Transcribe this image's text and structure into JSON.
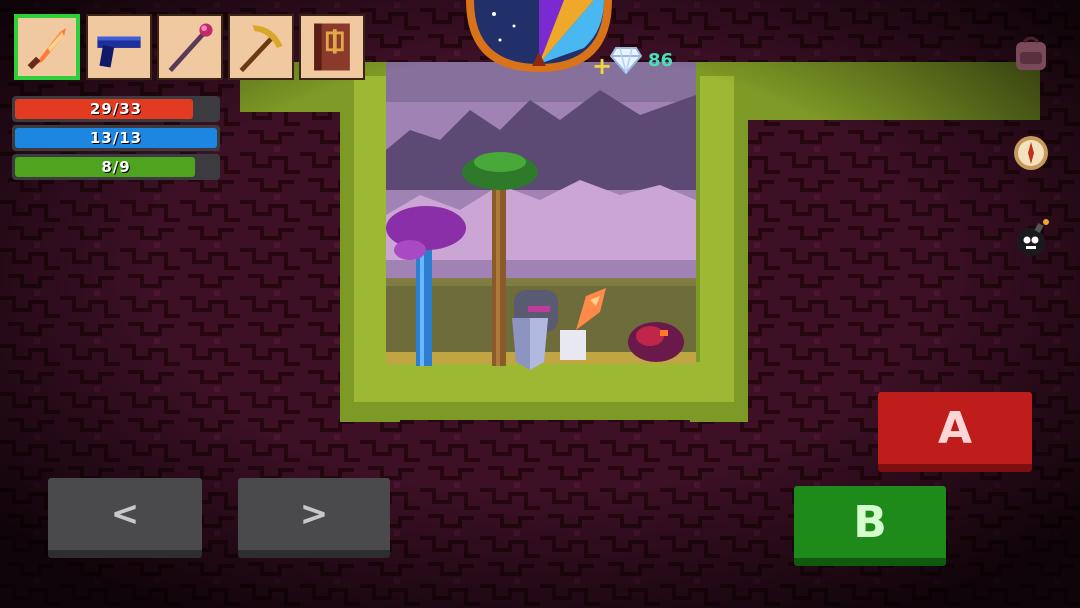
{
  "hotbar": {
    "selected_index": 0,
    "items": [
      {
        "name": "fire-sword",
        "icon": "flame-sword-icon"
      },
      {
        "name": "blue-pistol",
        "icon": "pistol-icon"
      },
      {
        "name": "magic-staff",
        "icon": "staff-icon"
      },
      {
        "name": "golden-pickaxe",
        "icon": "pickaxe-icon"
      },
      {
        "name": "spell-book",
        "icon": "book-icon"
      }
    ]
  },
  "stats": {
    "health": {
      "text": "29/33",
      "current": 29,
      "max": 33,
      "color": "#e23b22"
    },
    "mana": {
      "text": "13/13",
      "current": 13,
      "max": 13,
      "color": "#1d86e0"
    },
    "stamina": {
      "text": "8/9",
      "current": 8,
      "max": 9,
      "color": "#4ea41e"
    }
  },
  "currency": {
    "plus": "+",
    "gems": "86",
    "gem_icon": "diamond-icon"
  },
  "clock": {
    "icon": "day-night-clock-icon"
  },
  "side_buttons": [
    {
      "name": "backpack",
      "icon": "backpack-icon"
    },
    {
      "name": "compass",
      "icon": "compass-icon"
    },
    {
      "name": "bomb",
      "icon": "bomb-icon"
    }
  ],
  "controls": {
    "left": "<",
    "right": ">",
    "a": "A",
    "b": "B"
  },
  "colors": {
    "cave": "#3a1024",
    "moss": "#8aa32a",
    "sky": "#7a5a9a",
    "ground": "#6f6e3c"
  }
}
